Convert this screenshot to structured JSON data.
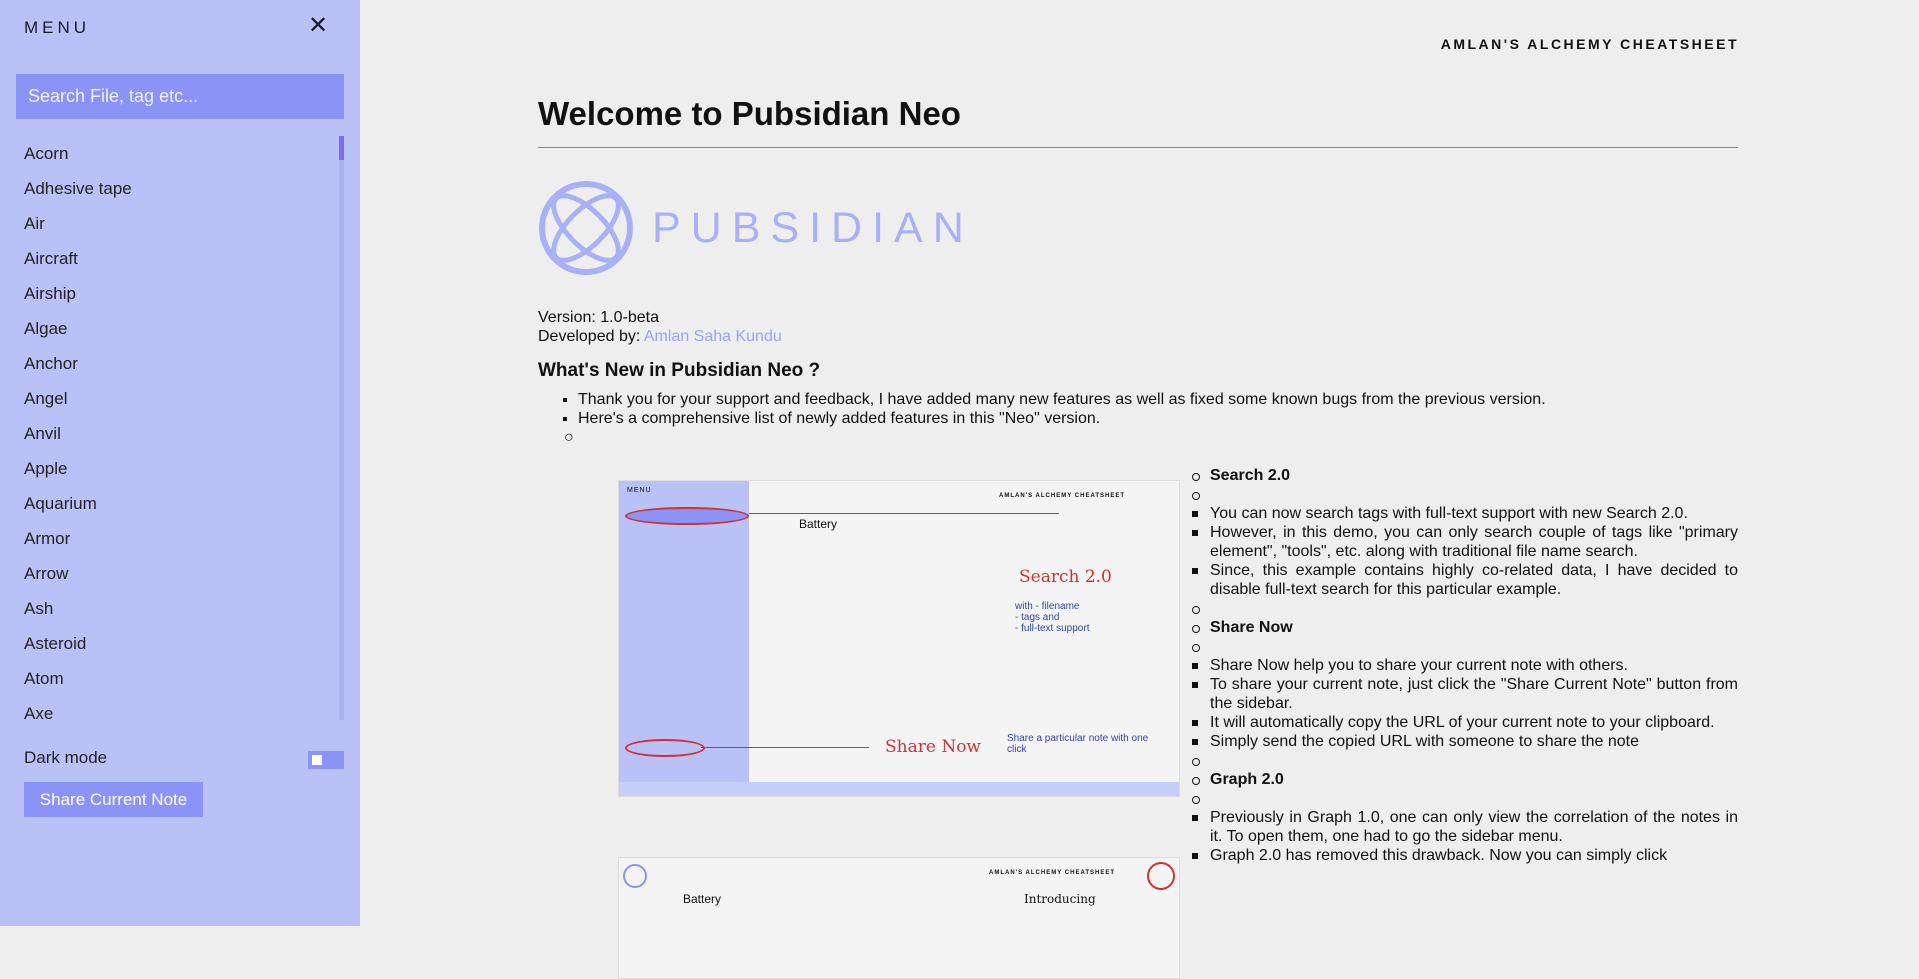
{
  "sidebar": {
    "menu_title": "MENU",
    "close_icon": "close-icon",
    "search_placeholder": "Search File, tag etc...",
    "items": [
      "Acorn",
      "Adhesive tape",
      "Air",
      "Aircraft",
      "Airship",
      "Algae",
      "Anchor",
      "Angel",
      "Anvil",
      "Apple",
      "Aquarium",
      "Armor",
      "Arrow",
      "Ash",
      "Asteroid",
      "Atom",
      "Axe"
    ],
    "dark_mode_label": "Dark mode",
    "share_button": "Share Current Note"
  },
  "site_title": "AMLAN'S ALCHEMY CHEATSHEET",
  "page": {
    "title": "Welcome to Pubsidian Neo",
    "logo_text": "PUBSIDIAN",
    "version": "Version: 1.0-beta",
    "developed_label": "Developed by: ",
    "developer": "Amlan Saha Kundu",
    "whats_new": "What's New in Pubsidian Neo ?",
    "bullets": [
      "Thank you for your support and feedback, I have added many new features as well as fixed some known bugs from the previous version.",
      "Here's a comprehensive list of newly added features in this \"Neo\" version."
    ]
  },
  "features": [
    {
      "title": "Search 2.0",
      "points": [
        "You can now search tags with full-text support with new Search 2.0.",
        "However, in this demo, you can only search couple of tags like \"primary element\", \"tools\", etc. along with traditional file name search.",
        "Since, this example contains highly co-related data, I have decided to disable full-text search for this particular example."
      ]
    },
    {
      "title": "Share Now",
      "points": [
        "Share Now help you to share your current note with others.",
        "To share your current note, just click the \"Share Current Note\" button from the sidebar.",
        "It will automatically copy the URL of your current note to your clipboard.",
        "Simply send the copied URL with someone to share the note"
      ]
    },
    {
      "title": "Graph 2.0",
      "points": [
        "Previously in Graph 1.0, one can only view the correlation of the notes in it. To open them, one had to go the sidebar menu.",
        "Graph 2.0 has removed this drawback. Now you can simply click"
      ]
    }
  ],
  "screenshot1": {
    "menu": "MENU",
    "header": "AMLAN'S ALCHEMY CHEATSHEET",
    "note_title": "Battery",
    "search_note": "Search 2.0",
    "share_note": "Share Now",
    "search_annot": "with - filename\n- tags and\n- full-text support",
    "share_annot": "Share a particular note with one click"
  },
  "screenshot2": {
    "header": "AMLAN'S ALCHEMY CHEATSHEET",
    "note_title": "Battery",
    "annot": "Introducing"
  },
  "colors": {
    "sidebar": "#b9c1f7",
    "accent": "#8b93f7",
    "link": "#9aa2f7",
    "annotation": "#cc3333"
  }
}
